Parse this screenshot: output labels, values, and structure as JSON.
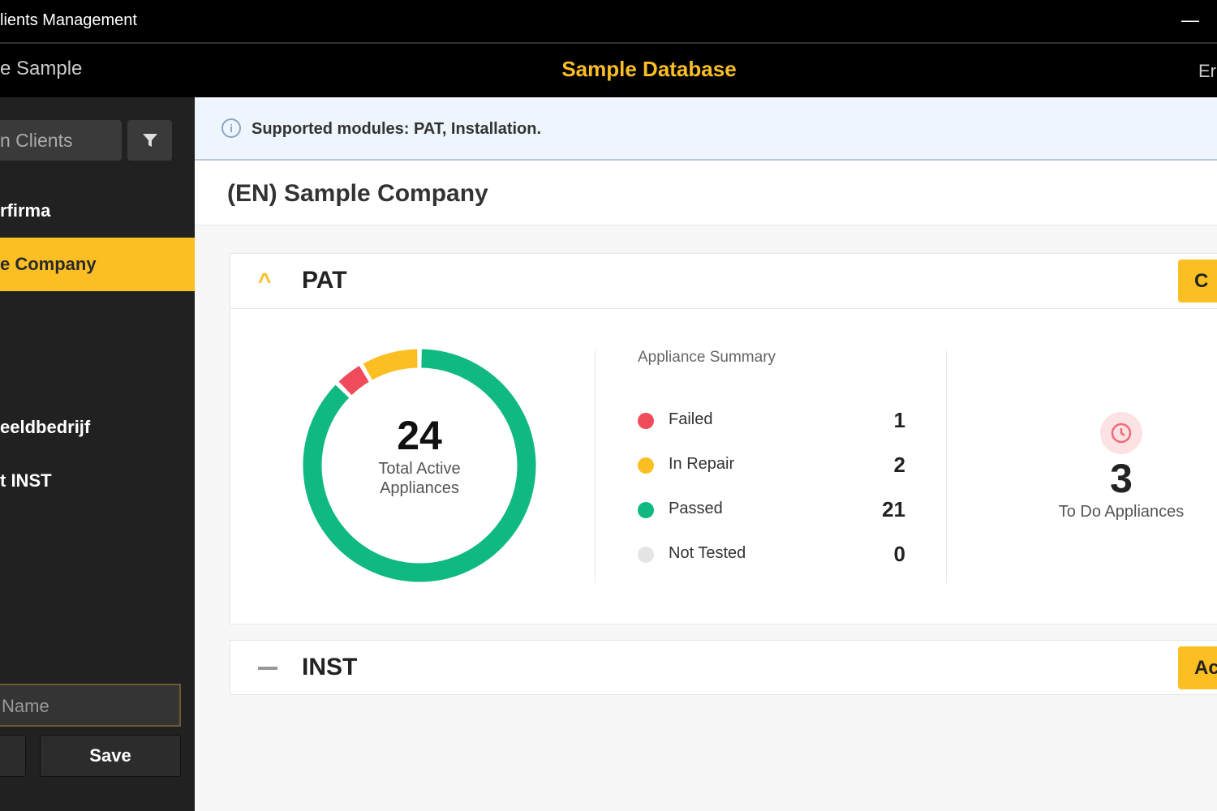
{
  "titlebar": {
    "title": "lients Management",
    "minimize": "—"
  },
  "header": {
    "left": "e Sample",
    "center": "Sample Database",
    "right": "Er"
  },
  "sidebar": {
    "search_placeholder": "n Clients",
    "filter_icon": "filter-icon",
    "items": [
      {
        "label": "rfirma"
      },
      {
        "label": "e Company",
        "selected": true
      },
      {
        "label": "eeldbedrijf"
      },
      {
        "label": "t INST"
      }
    ],
    "name_placeholder": "Name",
    "save_label": "Save"
  },
  "info": {
    "text": "Supported modules: PAT, Installation.",
    "icon": "i"
  },
  "company": {
    "title": "(EN) Sample Company"
  },
  "pat": {
    "title": "PAT",
    "button_label": "C",
    "total": "24",
    "total_label": "Total Active Appliances",
    "summary_title": "Appliance Summary",
    "summary": [
      {
        "label": "Failed",
        "value": "1",
        "color": "#ef4b5a"
      },
      {
        "label": "In Repair",
        "value": "2",
        "color": "#fbbf24"
      },
      {
        "label": "Passed",
        "value": "21",
        "color": "#10b981"
      },
      {
        "label": "Not Tested",
        "value": "0",
        "color": "#e5e5e5"
      }
    ],
    "todo_value": "3",
    "todo_label": "To Do Appliances"
  },
  "inst": {
    "title": "INST",
    "button_label": "Ac"
  },
  "chart_data": {
    "type": "pie",
    "style": "donut",
    "categories": [
      "Passed",
      "Failed",
      "In Repair",
      "Not Tested"
    ],
    "values": [
      21,
      1,
      2,
      0
    ],
    "colors": [
      "#10b981",
      "#ef4b5a",
      "#fbbf24",
      "#e5e5e5"
    ],
    "total": 24
  }
}
